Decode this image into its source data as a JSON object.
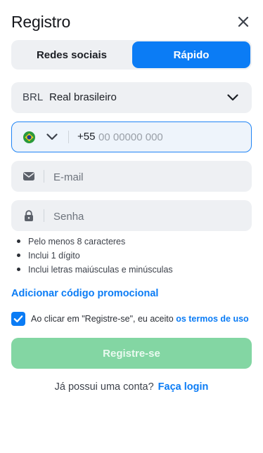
{
  "header": {
    "title": "Registro",
    "close_icon": "close-icon"
  },
  "tabs": [
    {
      "label": "Redes sociais",
      "active": false
    },
    {
      "label": "Rápido",
      "active": true
    }
  ],
  "currency": {
    "code": "BRL",
    "name": "Real brasileiro",
    "icon": "chevron-down-icon"
  },
  "phone": {
    "flag_icon": "brazil-flag-icon",
    "prefix": "+55",
    "placeholder": "00 00000 000",
    "value": ""
  },
  "email": {
    "icon": "envelope-icon",
    "placeholder": "E-mail",
    "value": ""
  },
  "password": {
    "icon": "lock-icon",
    "placeholder": "Senha",
    "value": ""
  },
  "password_rules": [
    "Pelo menos 8 caracteres",
    "Inclui 1 dígito",
    "Inclui letras maiúsculas e minúsculas"
  ],
  "promo_link": "Adicionar código promocional",
  "terms": {
    "checked": true,
    "text": "Ao clicar em \"Registre-se\", eu aceito ",
    "link": "os termos de uso"
  },
  "submit_label": "Registre-se",
  "login": {
    "text": "Já possui uma conta?",
    "link": "Faça login"
  },
  "colors": {
    "accent": "#0b7cf5",
    "submit_disabled": "#83d6a3",
    "field_bg": "#eef0f3"
  }
}
